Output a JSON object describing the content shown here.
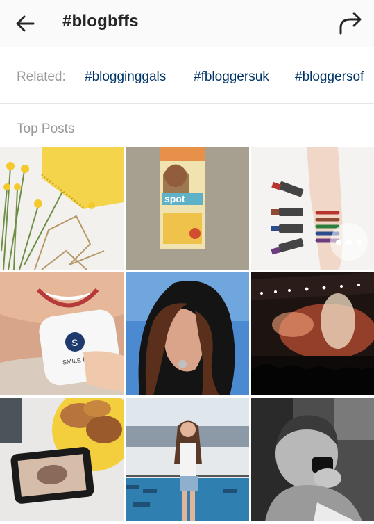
{
  "header": {
    "title": "#blogbffs",
    "back_icon": "arrow-left-icon",
    "share_icon": "share-arrow-icon"
  },
  "related": {
    "label": "Related:",
    "tags": [
      "#blogginggals",
      "#fbloggersuk",
      "#bloggersof"
    ]
  },
  "top_posts": {
    "title": "Top Posts",
    "posts": [
      {
        "name": "post-flowers-notebook"
      },
      {
        "name": "post-spot-product-box",
        "text": "spot"
      },
      {
        "name": "post-lipstick-swatches"
      },
      {
        "name": "post-smile-brilliant",
        "text": "SMILE BRILLIANT"
      },
      {
        "name": "post-hooded-woman"
      },
      {
        "name": "post-concert-stage"
      },
      {
        "name": "post-phone-pastries"
      },
      {
        "name": "post-cruise-deck-girl"
      },
      {
        "name": "post-bw-boy-phone"
      }
    ]
  },
  "colors": {
    "accent_link": "#003569",
    "muted_text": "#999999",
    "header_bg": "#fafafa"
  }
}
